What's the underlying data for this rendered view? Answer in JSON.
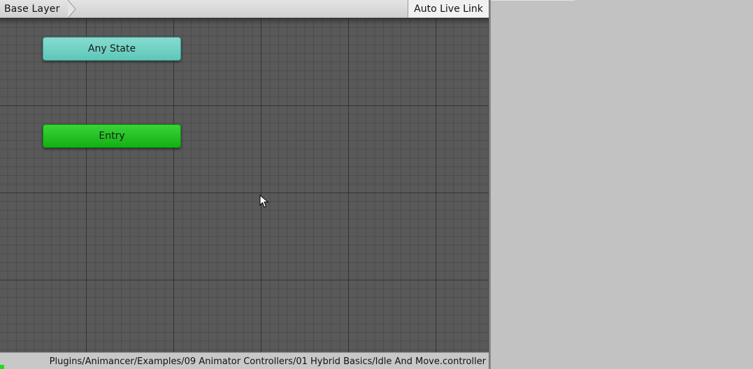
{
  "toolbar": {
    "breadcrumb_label": "Base Layer",
    "auto_live_link_label": "Auto Live Link"
  },
  "graph": {
    "states": [
      {
        "label": "Any State",
        "color": "#6fd1c3"
      },
      {
        "label": "Entry",
        "color": "#1ec31e"
      }
    ]
  },
  "status_bar": {
    "path": "Plugins/Animancer/Examples/09 Animator Controllers/01 Hybrid Basics/Idle And Move.controller",
    "indicator_color": "#19e019"
  },
  "colors": {
    "canvas": "#595959",
    "panel": "#c2c2c2"
  },
  "icons": {
    "breadcrumb": "chevron-right-icon",
    "cursor": "mouse-pointer-icon"
  }
}
